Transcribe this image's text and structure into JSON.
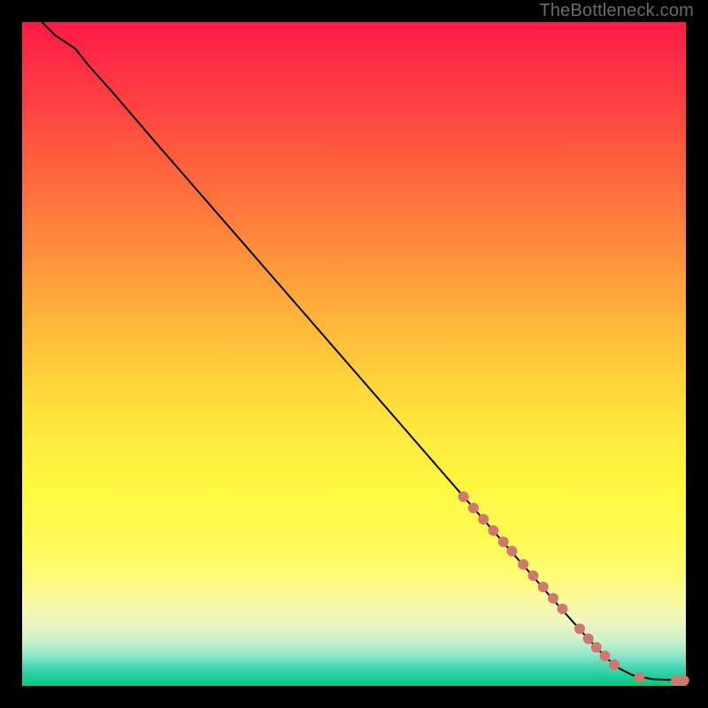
{
  "watermark": "TheBottleneck.com",
  "chart_data": {
    "type": "line",
    "title": "",
    "xlabel": "",
    "ylabel": "",
    "xlim": [
      0,
      100
    ],
    "ylim": [
      0,
      100
    ],
    "curve": [
      {
        "x": 3,
        "y": 100
      },
      {
        "x": 5,
        "y": 98
      },
      {
        "x": 8,
        "y": 96
      },
      {
        "x": 10,
        "y": 93.5
      },
      {
        "x": 14,
        "y": 89
      },
      {
        "x": 20,
        "y": 82
      },
      {
        "x": 30,
        "y": 70.5
      },
      {
        "x": 40,
        "y": 59
      },
      {
        "x": 50,
        "y": 47.5
      },
      {
        "x": 60,
        "y": 36
      },
      {
        "x": 70,
        "y": 24.5
      },
      {
        "x": 80,
        "y": 13
      },
      {
        "x": 85,
        "y": 7.4
      },
      {
        "x": 88,
        "y": 4.2
      },
      {
        "x": 90,
        "y": 2.6
      },
      {
        "x": 92,
        "y": 1.6
      },
      {
        "x": 95,
        "y": 1.0
      },
      {
        "x": 100,
        "y": 0.8
      }
    ],
    "points": [
      {
        "x": 66.5,
        "y": 28.5,
        "r": 6
      },
      {
        "x": 68.0,
        "y": 26.8,
        "r": 6
      },
      {
        "x": 69.5,
        "y": 25.1,
        "r": 6
      },
      {
        "x": 71.0,
        "y": 23.4,
        "r": 6
      },
      {
        "x": 72.5,
        "y": 21.7,
        "r": 6
      },
      {
        "x": 73.8,
        "y": 20.3,
        "r": 6
      },
      {
        "x": 75.5,
        "y": 18.3,
        "r": 6
      },
      {
        "x": 77.0,
        "y": 16.6,
        "r": 6
      },
      {
        "x": 78.5,
        "y": 14.9,
        "r": 6
      },
      {
        "x": 80.0,
        "y": 13.2,
        "r": 6
      },
      {
        "x": 81.4,
        "y": 11.6,
        "r": 6
      },
      {
        "x": 84.0,
        "y": 8.6,
        "r": 6
      },
      {
        "x": 85.3,
        "y": 7.1,
        "r": 6
      },
      {
        "x": 86.5,
        "y": 5.8,
        "r": 6
      },
      {
        "x": 87.8,
        "y": 4.5,
        "r": 6
      },
      {
        "x": 89.2,
        "y": 3.2,
        "r": 6
      },
      {
        "x": 93.0,
        "y": 1.3,
        "r": 6
      },
      {
        "x": 98.5,
        "y": 0.8,
        "r": 6
      },
      {
        "x": 99.7,
        "y": 0.8,
        "r": 6
      }
    ],
    "point_color": "#d0776e",
    "line_color": "#000000"
  }
}
